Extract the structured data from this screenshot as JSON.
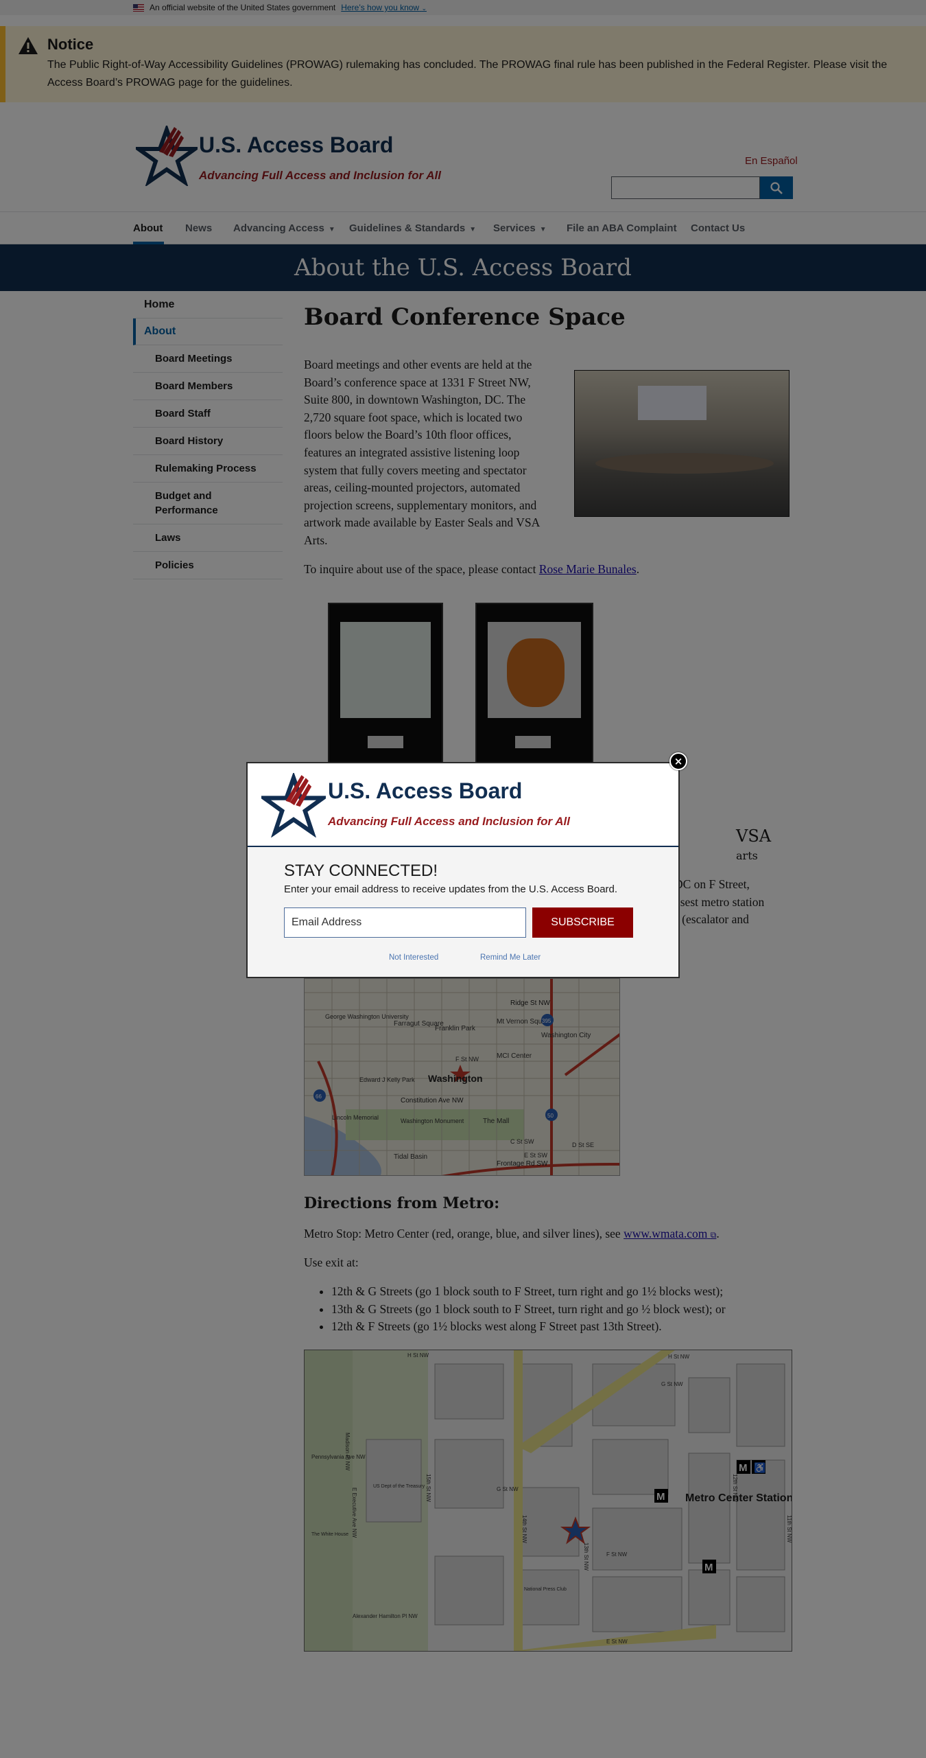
{
  "gov_banner": {
    "text": "An official website of the United States government",
    "link": "Here’s how you know"
  },
  "notice": {
    "title": "Notice",
    "text": "The Public Right-of-Way Accessibility Guidelines (PROWAG) rulemaking has concluded. The PROWAG final rule has been published in the Federal Register. Please visit the Access Board’s PROWAG page for the guidelines."
  },
  "header": {
    "title": "U.S. Access Board",
    "tagline": "Advancing Full Access and Inclusion for All",
    "espanol": "En Español",
    "search_icon": "search-icon"
  },
  "nav": {
    "items": [
      {
        "label": "About",
        "dropdown": false
      },
      {
        "label": "News",
        "dropdown": false
      },
      {
        "label": "Advancing Access",
        "dropdown": true
      },
      {
        "label": "Guidelines & Standards",
        "dropdown": true
      },
      {
        "label": "Services",
        "dropdown": true
      },
      {
        "label": "File an ABA Complaint",
        "dropdown": false
      },
      {
        "label": "Contact Us",
        "dropdown": false
      }
    ]
  },
  "page_title": "About the U.S. Access Board",
  "sidebar": {
    "home": "Home",
    "about": "About",
    "items": [
      "Board Meetings",
      "Board Members",
      "Board Staff",
      "Board History",
      "Rulemaking Process",
      "Budget and Performance",
      "Laws",
      "Policies"
    ]
  },
  "main": {
    "heading": "Board Conference Space",
    "intro": "Board meetings and other events are held at the Board’s conference space at 1331 F Street NW, Suite 800, in downtown Washington, DC.  The 2,720 square foot space, which is located two floors below the Board’s 10th floor offices, features an integrated assistive listening loop system that fully covers meeting and spectator areas, ceiling-mounted projectors, automated projection screens, supplementary monitors, and artwork made available by Easter Seals and VSA Arts.",
    "inquire_prefix": "To inquire about use of the space, please contact ",
    "inquire_link": "Rose Marie Bunales",
    "inquire_suffix": ".",
    "vsa_logo": "VSA",
    "vsa_arts": "arts",
    "partial_line1": "DC on F Street,",
    "partial_line2": "osest metro station",
    "partial_line3": "s (escalator and",
    "directions_heading": "Directions from Metro:",
    "metro_stop_prefix": "Metro Stop:  Metro Center (red, orange, blue, and silver lines), see ",
    "metro_link": "www.wmata.com",
    "metro_suffix": ".",
    "use_exit": "Use exit at:",
    "exits": [
      "12th & G Streets (go 1 block south to F Street, turn right and go 1½ blocks west);",
      "13th & G Streets (go 1 block south to F Street, turn right and go ½ block west); or",
      "12th & F Streets (go 1½ blocks west along F Street past 13th Street)."
    ]
  },
  "map1_labels": {
    "city": "Washington",
    "ridge": "Ridge St NW",
    "mt_vernon": "Mt Vernon Square",
    "franklin": "Franklin Park",
    "farragut": "Farragut Square",
    "george": "George Washington University",
    "mcicenter": "MCI Center",
    "wash_city": "Washington City",
    "constitution": "Constitution Ave NW",
    "lincoln": "Lincoln Memorial",
    "wash_monument": "Washington Monument",
    "mall": "The Mall",
    "tidal": "Tidal Basin",
    "kelly": "Edward J Kelly Park",
    "f_st": "F St NW",
    "frontage": "Frontage Rd SW",
    "c_st": "C St SW",
    "d_st": "D St SE",
    "e_st": "E St SW",
    "i395": "395",
    "i66": "66",
    "r50": "50"
  },
  "map2_labels": {
    "h_st": "H St NW",
    "h_st_right": "H St NW",
    "penn": "Pennsylvania Ave NW",
    "g_st": "G St NW",
    "g_st_right": "G St NW",
    "f_st": "F St NW",
    "e_st": "E St NW",
    "madison": "Madison Pl NW",
    "fifteenth": "15th St NW",
    "fourteenth": "14th St NW",
    "thirteenth": "13th St NW",
    "twelfth": "12th St NW",
    "eleventh": "11th St NW",
    "executive": "E Executive Ave NW",
    "hamilton": "Alexander Hamilton Pl NW",
    "treasury": "US Dept of the Treasury",
    "white_house": "The White House",
    "press_club": "National Press Club",
    "metro_center": "Metro Center Station",
    "metro_m": "M",
    "ada_glyph": "♿"
  },
  "modal": {
    "title": "U.S. Access Board",
    "tagline": "Advancing Full Access and Inclusion for All",
    "close_glyph": "×",
    "heading": "STAY CONNECTED!",
    "description": "Enter your email address to receive updates from the U.S. Access Board.",
    "email_placeholder": "Email Address",
    "subscribe": "SUBSCRIBE",
    "not_interested": "Not Interested",
    "remind_later": "Remind Me Later"
  },
  "colors": {
    "navy": "#112e51",
    "red": "#981b1e",
    "primary": "#005ea2",
    "subscribe": "#8b0000",
    "notice_bg": "#fff4d6",
    "notice_border": "#ffbe2e"
  }
}
